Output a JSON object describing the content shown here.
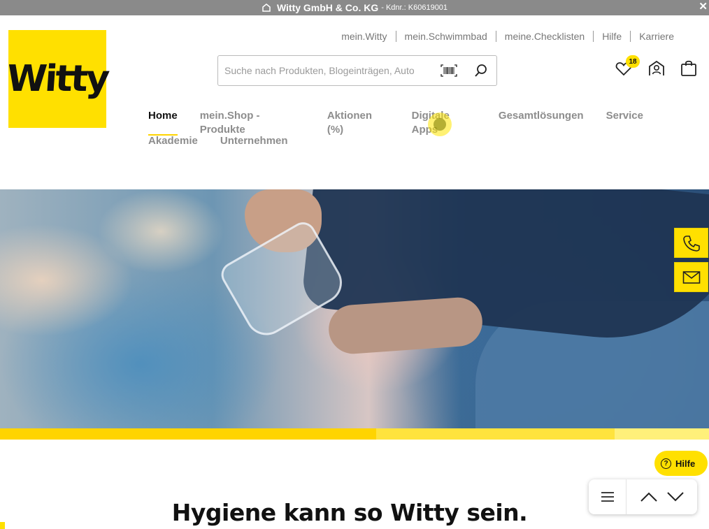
{
  "topbar": {
    "icon": "home-icon",
    "company": "Witty GmbH & Co. KG",
    "kdnr": "- Kdnr.: K60619001",
    "close_icon": "close-icon"
  },
  "logo": {
    "text": "Witty"
  },
  "top_links": [
    {
      "label": "mein.Witty"
    },
    {
      "label": "mein.Schwimmbad"
    },
    {
      "label": "meine.Checklisten"
    },
    {
      "label": "Hilfe"
    },
    {
      "label": "Karriere"
    }
  ],
  "search": {
    "placeholder": "Suche nach Produkten, Blogeinträgen, Auto",
    "barcode_icon": "barcode-icon",
    "search_icon": "search-icon"
  },
  "header_icons": {
    "wishlist_icon": "heart-icon",
    "wishlist_count": "18",
    "account_icon": "account-icon",
    "cart_icon": "shopping-bag-icon"
  },
  "nav": {
    "row1": [
      {
        "label": "Home",
        "active": true
      },
      {
        "label": "mein.Shop - Produkte"
      },
      {
        "label": "Aktionen (%)"
      },
      {
        "label": "Digitale Apps"
      },
      {
        "label": "Gesamtlösungen"
      },
      {
        "label": "Service"
      }
    ],
    "row2": [
      {
        "label": "Akademie"
      },
      {
        "label": "Unternehmen"
      }
    ]
  },
  "side_buttons": {
    "phone_icon": "phone-icon",
    "mail_icon": "mail-icon"
  },
  "help_button": {
    "label": "Hilfe",
    "icon": "question-icon"
  },
  "scroll_controls": {
    "menu_icon": "menu-icon",
    "up_icon": "chevron-up-icon",
    "down_icon": "chevron-down-icon"
  },
  "headline": "Hygiene kann so Witty sein.",
  "colors": {
    "brand_yellow": "#ffe000",
    "bar_1": "#ffd400",
    "bar_2": "#ffe33d",
    "bar_3": "#fff07a"
  }
}
